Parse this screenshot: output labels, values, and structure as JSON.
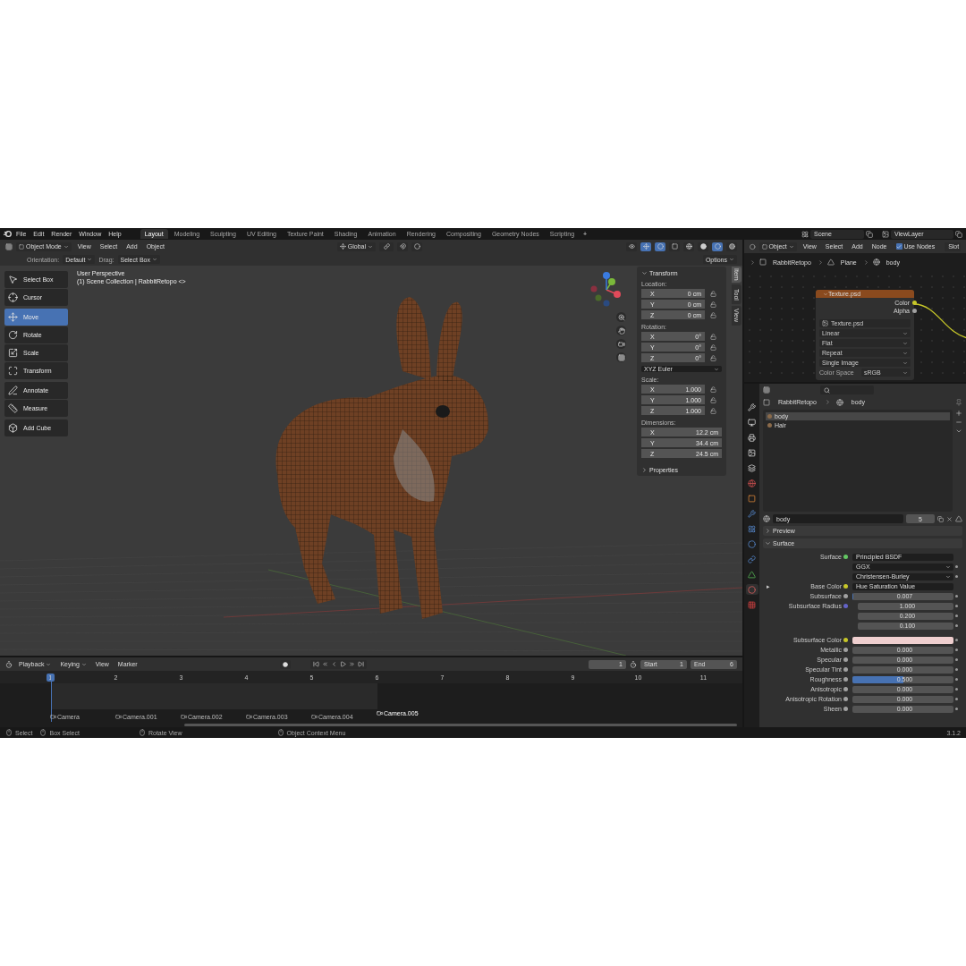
{
  "topbar": {
    "menus": [
      "File",
      "Edit",
      "Render",
      "Window",
      "Help"
    ],
    "workspaces": [
      {
        "label": "Layout",
        "selected": true
      },
      {
        "label": "Modeling",
        "selected": false
      },
      {
        "label": "Sculpting",
        "selected": false
      },
      {
        "label": "UV Editing",
        "selected": false
      },
      {
        "label": "Texture Paint",
        "selected": false
      },
      {
        "label": "Shading",
        "selected": false
      },
      {
        "label": "Animation",
        "selected": false
      },
      {
        "label": "Rendering",
        "selected": false
      },
      {
        "label": "Compositing",
        "selected": false
      },
      {
        "label": "Geometry Nodes",
        "selected": false
      },
      {
        "label": "Scripting",
        "selected": false
      }
    ],
    "add_tab": "+",
    "scene": "Scene",
    "view_layer": "ViewLayer"
  },
  "viewport_header": {
    "mode": "Object Mode",
    "menus": [
      "View",
      "Select",
      "Add",
      "Object"
    ],
    "orientation": "Global",
    "options": "Options"
  },
  "tool_settings": {
    "orientation_label": "Orientation:",
    "orientation": "Default",
    "drag_label": "Drag:",
    "drag": "Select Box"
  },
  "toolbar": [
    {
      "tools": [
        {
          "label": "Select Box",
          "selected": false
        },
        {
          "label": "Cursor",
          "selected": false
        }
      ]
    },
    {
      "tools": [
        {
          "label": "Move",
          "selected": true
        },
        {
          "label": "Rotate",
          "selected": false
        },
        {
          "label": "Scale",
          "selected": false
        },
        {
          "label": "Transform",
          "selected": false
        }
      ]
    },
    {
      "tools": [
        {
          "label": "Annotate",
          "selected": false
        },
        {
          "label": "Measure",
          "selected": false
        }
      ]
    },
    {
      "tools": [
        {
          "label": "Add Cube",
          "selected": false
        }
      ]
    }
  ],
  "viewport": {
    "view_name": "User Perspective",
    "collection": "(1) Scene Collection | RabbitRetopo <>"
  },
  "sidebar_tabs": [
    {
      "label": "Item",
      "selected": true
    },
    {
      "label": "Tool",
      "selected": false
    },
    {
      "label": "View",
      "selected": false
    }
  ],
  "transform_panel": {
    "title": "Transform",
    "groups": [
      {
        "label": "Location:",
        "fields": [
          {
            "axis": "X",
            "value": "0 cm"
          },
          {
            "axis": "Y",
            "value": "0 cm"
          },
          {
            "axis": "Z",
            "value": "0 cm"
          }
        ],
        "locks": true
      },
      {
        "label": "Rotation:",
        "fields": [
          {
            "axis": "X",
            "value": "0°"
          },
          {
            "axis": "Y",
            "value": "0°"
          },
          {
            "axis": "Z",
            "value": "0°"
          }
        ],
        "locks": true,
        "mode": "XYZ Euler"
      },
      {
        "label": "Scale:",
        "fields": [
          {
            "axis": "X",
            "value": "1.000"
          },
          {
            "axis": "Y",
            "value": "1.000"
          },
          {
            "axis": "Z",
            "value": "1.000"
          }
        ],
        "locks": true
      },
      {
        "label": "Dimensions:",
        "fields": [
          {
            "axis": "X",
            "value": "12.2 cm"
          },
          {
            "axis": "Y",
            "value": "34.4 cm"
          },
          {
            "axis": "Z",
            "value": "24.5 cm"
          }
        ],
        "locks": false
      }
    ],
    "properties": "Properties"
  },
  "node_editor": {
    "type": "Object",
    "menus": [
      "View",
      "Select",
      "Add",
      "Node"
    ],
    "use_nodes": {
      "label": "Use Nodes",
      "checked": true
    },
    "slot": "Slot",
    "breadcrumb": [
      "RabbitRetopo",
      "Plane",
      "body"
    ],
    "node": {
      "title": "Texture.psd",
      "outputs": [
        {
          "label": "Color",
          "color": "#c7c729"
        },
        {
          "label": "Alpha",
          "color": "#a1a1a1"
        }
      ],
      "image": "Texture.psd",
      "dropdowns": [
        "Linear",
        "Flat",
        "Repeat",
        "Single Image"
      ],
      "color_space_label": "Color Space",
      "color_space": "sRGB"
    }
  },
  "properties": {
    "breadcrumb": [
      "RabbitRetopo",
      "body"
    ],
    "materials": [
      {
        "name": "body",
        "selected": true
      },
      {
        "name": "Hair",
        "selected": false
      }
    ],
    "material_name": "body",
    "users": "5",
    "panels": [
      {
        "title": "Preview",
        "expanded": false
      },
      {
        "title": "Surface",
        "expanded": true
      }
    ],
    "rows": [
      {
        "kind": "link",
        "label": "Surface",
        "value": "Principled BSDF",
        "color": "#63c763"
      },
      {
        "kind": "dropdown",
        "value": "GGX"
      },
      {
        "kind": "dropdown",
        "value": "Christensen-Burley"
      },
      {
        "kind": "link",
        "label": "Base Color",
        "value": "Hue Saturation Value",
        "color": "#c7c729",
        "expand": "▸"
      },
      {
        "kind": "slider",
        "label": "Subsurface",
        "value": "0.007",
        "level": 0.007,
        "color": "#a1a1a1"
      },
      {
        "kind": "vector",
        "label": "Subsurface Radius",
        "values": [
          "1.000",
          "0.200",
          "0.100"
        ],
        "color": "#6363c7"
      },
      {
        "kind": "swatch",
        "label": "Subsurface Color",
        "swatch": {
          "color": "#efcfcf"
        },
        "color": "#c7c729"
      },
      {
        "kind": "slider",
        "label": "Metallic",
        "value": "0.000",
        "level": 0,
        "color": "#a1a1a1"
      },
      {
        "kind": "slider",
        "label": "Specular",
        "value": "0.000",
        "level": 0,
        "color": "#a1a1a1"
      },
      {
        "kind": "slider",
        "label": "Specular Tint",
        "value": "0.000",
        "level": 0,
        "color": "#a1a1a1"
      },
      {
        "kind": "slider",
        "label": "Roughness",
        "value": "0.500",
        "level": 0.5,
        "color": "#a1a1a1"
      },
      {
        "kind": "slider",
        "label": "Anisotropic",
        "value": "0.000",
        "level": 0,
        "color": "#a1a1a1"
      },
      {
        "kind": "slider",
        "label": "Anisotropic Rotation",
        "value": "0.000",
        "level": 0,
        "color": "#a1a1a1"
      },
      {
        "kind": "slider",
        "label": "Sheen",
        "value": "0.000",
        "level": 0,
        "color": "#a1a1a1"
      }
    ]
  },
  "timeline": {
    "menus": [
      "Playback",
      "Keying",
      "View",
      "Marker"
    ],
    "current_frame": "1",
    "start_label": "Start",
    "start": "1",
    "end_label": "End",
    "end": "6",
    "frames": [
      {
        "label": "1",
        "selected": true
      },
      {
        "label": "2",
        "selected": false
      },
      {
        "label": "3",
        "selected": false
      },
      {
        "label": "4",
        "selected": false
      },
      {
        "label": "5",
        "selected": false
      },
      {
        "label": "6",
        "selected": false
      },
      {
        "label": "7",
        "selected": false
      },
      {
        "label": "8",
        "selected": false
      },
      {
        "label": "9",
        "selected": false
      },
      {
        "label": "10",
        "selected": false
      },
      {
        "label": "11",
        "selected": false
      }
    ],
    "markers": [
      {
        "label": "Camera",
        "selected": false
      },
      {
        "label": "Camera.001",
        "selected": false
      },
      {
        "label": "Camera.002",
        "selected": false
      },
      {
        "label": "Camera.003",
        "selected": false
      },
      {
        "label": "Camera.004",
        "selected": false
      },
      {
        "label": "Camera.005",
        "selected": true
      }
    ]
  },
  "status_bar": {
    "items": [
      "Select",
      "Box Select",
      "Rotate View",
      "Object Context Menu"
    ],
    "version": "3.1.2"
  }
}
